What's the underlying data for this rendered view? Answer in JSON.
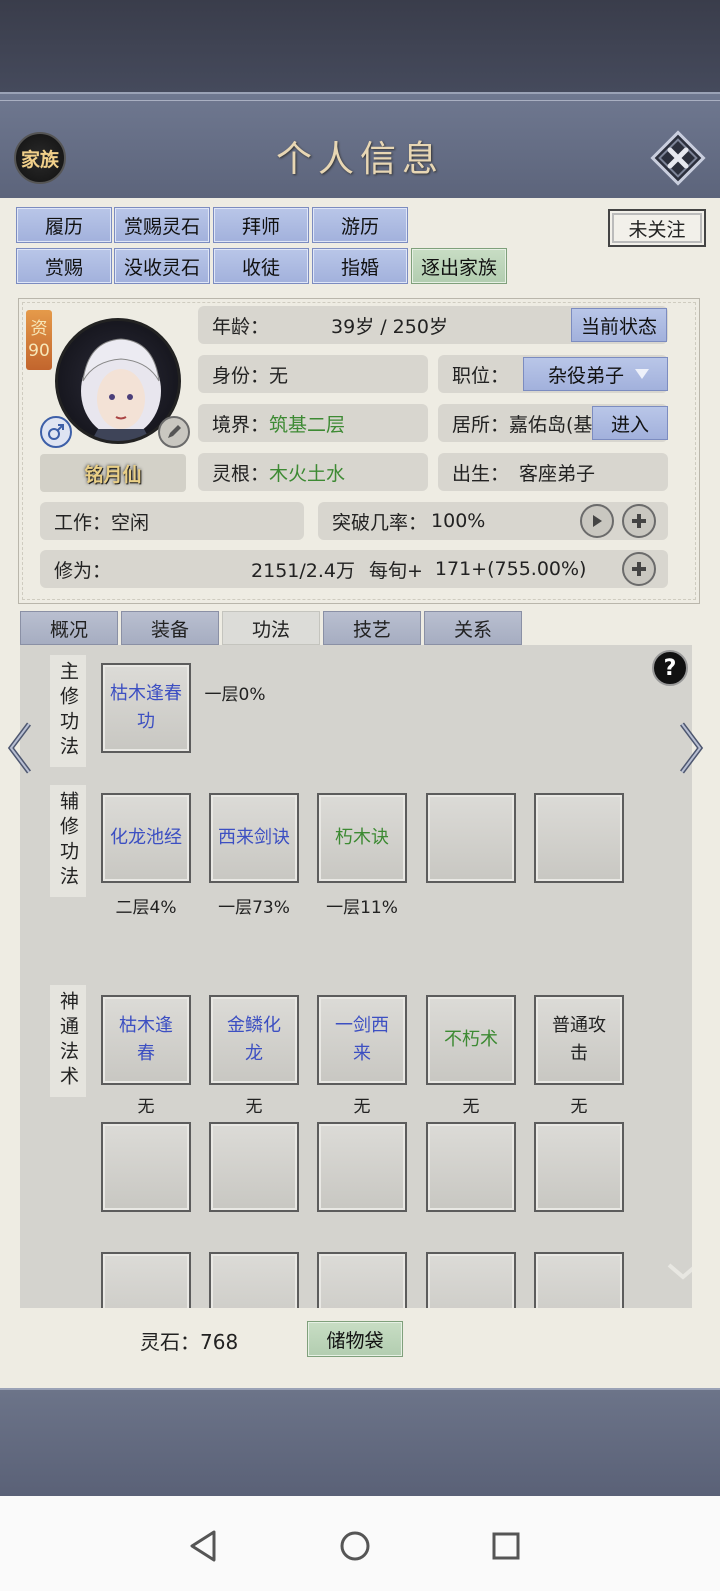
{
  "header": {
    "family_label": "家族",
    "title": "个人信息"
  },
  "actions_row1": [
    "履历",
    "赏赐灵石",
    "拜师",
    "游历"
  ],
  "actions_row2": [
    "赏赐",
    "没收灵石",
    "收徒",
    "指婚",
    "逐出家族"
  ],
  "follow_label": "未关注",
  "character": {
    "aptitude_label": "资",
    "aptitude_value": "90",
    "name": "铭月仙",
    "age_label": "年龄：",
    "age_value": "39岁 / 250岁",
    "status_button": "当前状态",
    "identity_label": "身份：",
    "identity_value": "无",
    "position_label": "职位：",
    "position_value": "杂役弟子",
    "realm_label": "境界：",
    "realm_value": "筑基二层",
    "residence_label": "居所：",
    "residence_value": "嘉佑岛(基",
    "enter_button": "进入",
    "root_label": "灵根：",
    "root_value": "木火土水",
    "origin_label": "出生：",
    "origin_value": "客座弟子",
    "work_label": "工作：",
    "work_value": "空闲",
    "breakthrough_label": "突破几率：",
    "breakthrough_value": "100%",
    "cultivation_label": "修为：",
    "cultivation_value": "2151/2.4万",
    "per_period_label": "每旬+",
    "per_period_value": "171+(755.00%)"
  },
  "tabs": [
    "概况",
    "装备",
    "功法",
    "技艺",
    "关系"
  ],
  "active_tab": "功法",
  "skills": {
    "main_label": "主修功法",
    "main": {
      "name": "枯木逢春功",
      "level": "一层0%"
    },
    "aux_label": "辅修功法",
    "aux": [
      {
        "name": "化龙池经",
        "level": "二层4%",
        "color": "#3c4fc2"
      },
      {
        "name": "西来剑诀",
        "level": "一层73%",
        "color": "#3c4fc2"
      },
      {
        "name": "朽木诀",
        "level": "一层11%",
        "color": "#3d8a33"
      }
    ],
    "arts_label": "神通法术",
    "arts": [
      {
        "name": "枯木逢春",
        "status": "无",
        "color": "#3c4fc2"
      },
      {
        "name": "金鳞化龙",
        "status": "无",
        "color": "#3c4fc2"
      },
      {
        "name": "一剑西来",
        "status": "无",
        "color": "#3c4fc2"
      },
      {
        "name": "不朽术",
        "status": "无",
        "color": "#3d8a33"
      },
      {
        "name": "普通攻击",
        "status": "无",
        "color": "#222222"
      }
    ]
  },
  "footer": {
    "spirit_stone_label": "灵石：",
    "spirit_stone_value": "768",
    "bag_button": "储物袋"
  }
}
